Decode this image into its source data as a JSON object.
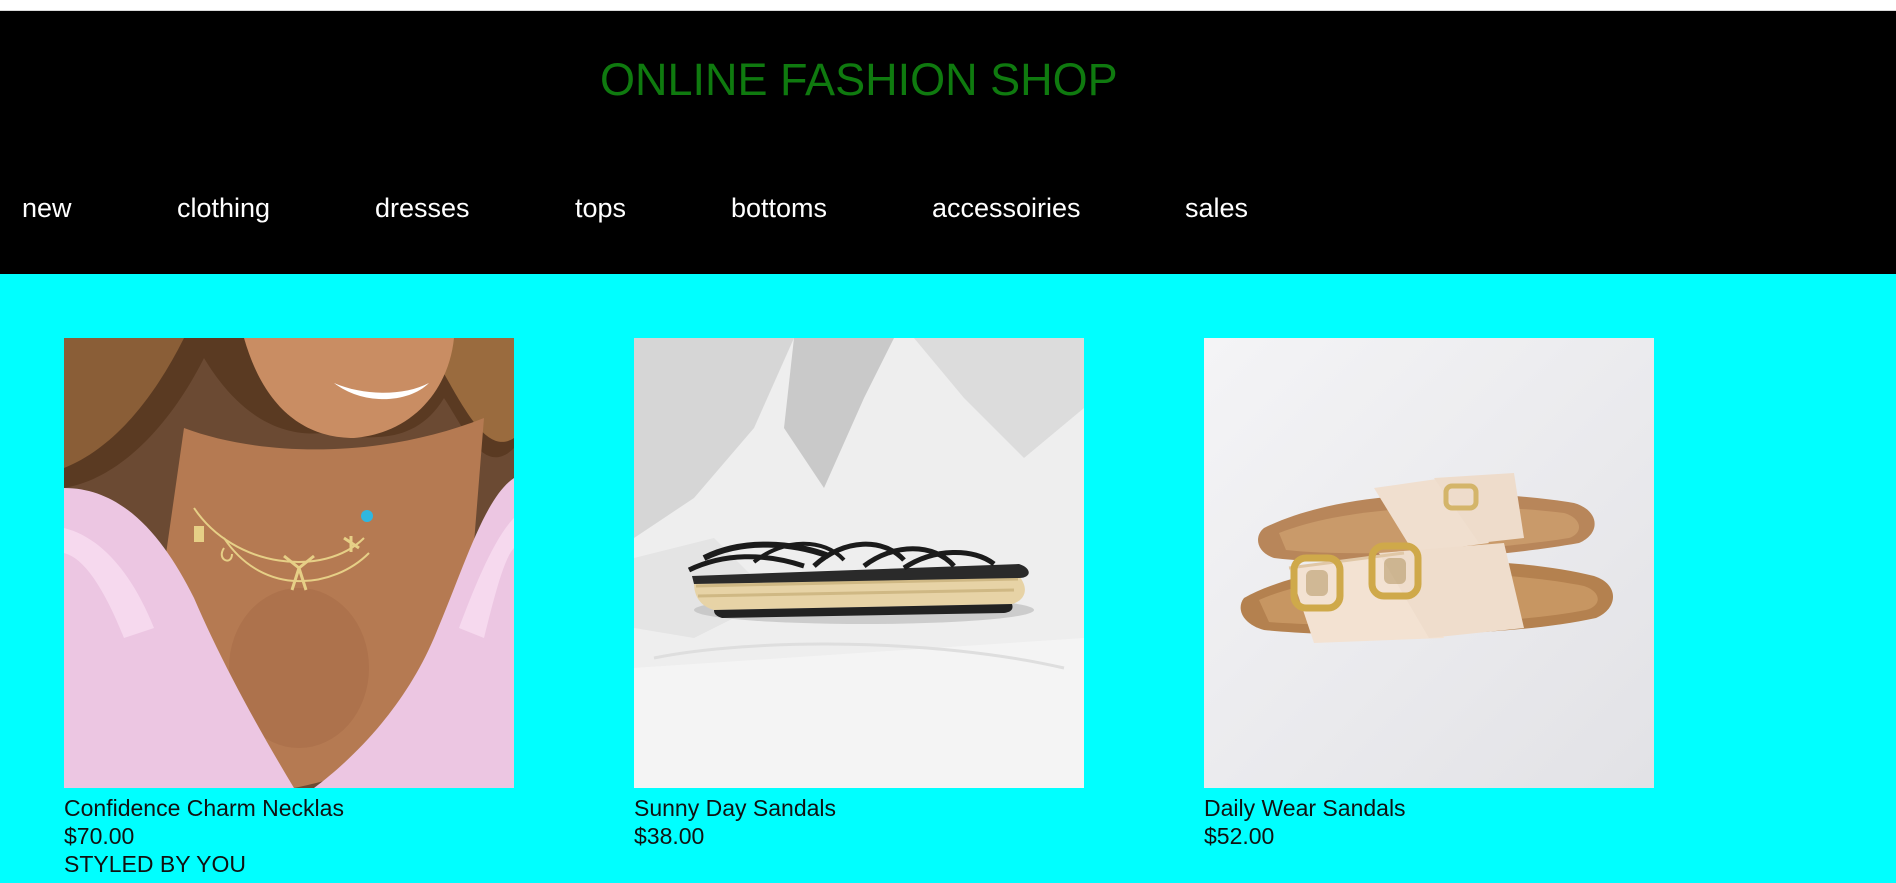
{
  "site": {
    "title": "ONLINE FASHION SHOP",
    "title_color": "#0f7a0f",
    "header_bg": "#000000",
    "page_bg": "#00ffff"
  },
  "nav": {
    "items": [
      {
        "label": "new"
      },
      {
        "label": "clothing"
      },
      {
        "label": "dresses"
      },
      {
        "label": "tops"
      },
      {
        "label": "bottoms"
      },
      {
        "label": "accessoiries"
      },
      {
        "label": "sales"
      }
    ]
  },
  "products": [
    {
      "name": "Confidence Charm Necklas",
      "price": "$70.00",
      "extra": "STYLED BY YOU",
      "image": "woman-wearing-charm-necklace-photo"
    },
    {
      "name": "Sunny Day Sandals",
      "price": "$38.00",
      "image": "black-strappy-espadrille-sandal-photo"
    },
    {
      "name": "Daily Wear Sandals",
      "price": "$52.00",
      "image": "cream-double-buckle-slide-sandals-photo"
    }
  ]
}
